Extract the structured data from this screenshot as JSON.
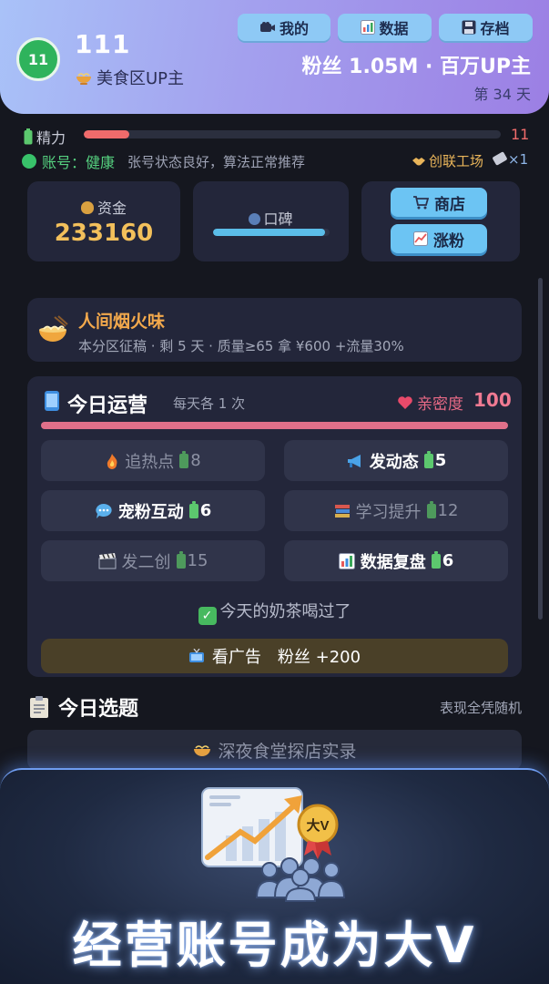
{
  "header": {
    "level": "11",
    "player_name": "111",
    "role": "美食区UP主",
    "buttons": [
      {
        "icon": "camera-icon",
        "label": "我的"
      },
      {
        "icon": "chart-icon",
        "label": "数据"
      },
      {
        "icon": "save-icon",
        "label": "存档"
      }
    ],
    "fans_text": "粉丝 1.05M · 百万UP主",
    "day_text": "第 34 天"
  },
  "energy": {
    "label": "精力",
    "value": "11",
    "fill_fraction": 0.11
  },
  "account": {
    "key": "账号：健康",
    "desc": "张号状态良好，算法正常推荐",
    "collab": "创联工场",
    "ticket": "×1"
  },
  "stats": {
    "money_label": "资金",
    "money_value": "233160",
    "reputation_label": "口碑",
    "reputation_fraction": 0.96,
    "shop_label": "商店",
    "grow_label": "涨粉"
  },
  "contest": {
    "title": "人间烟火味",
    "desc": "本分区征稿 · 剩 5 天 · 质量≥65 拿 ¥600 +流量30%"
  },
  "daily": {
    "title": "今日运营",
    "subtitle": "每天各 1 次",
    "intimacy_label": "亲密度",
    "intimacy_value": "100",
    "actions": [
      {
        "icon": "fire-icon",
        "label": "追热点",
        "cost": "8",
        "enabled": false
      },
      {
        "icon": "megaphone-icon",
        "label": "发动态",
        "cost": "5",
        "enabled": true
      },
      {
        "icon": "chat-bubble-icon",
        "label": "宠粉互动",
        "cost": "6",
        "enabled": true
      },
      {
        "icon": "books-icon",
        "label": "学习提升",
        "cost": "12",
        "enabled": false
      },
      {
        "icon": "clapperboard-icon",
        "label": "发二创",
        "cost": "15",
        "enabled": false
      },
      {
        "icon": "bar-chart-icon",
        "label": "数据复盘",
        "cost": "6",
        "enabled": true
      }
    ],
    "done_text": "今天的奶茶喝过了",
    "ad_label": "看广告",
    "ad_reward": "粉丝 +200"
  },
  "topics": {
    "title": "今日选题",
    "note": "表现全凭随机",
    "item": "深夜食堂探店实录"
  },
  "promo": {
    "badge": "大V",
    "title": "经营账号成为大V"
  },
  "colors": {
    "accent_gold": "#f3c05b",
    "energy_red": "#ef6b6b",
    "intimacy_pink": "#e0708a",
    "button_blue": "#6cc4f3"
  }
}
